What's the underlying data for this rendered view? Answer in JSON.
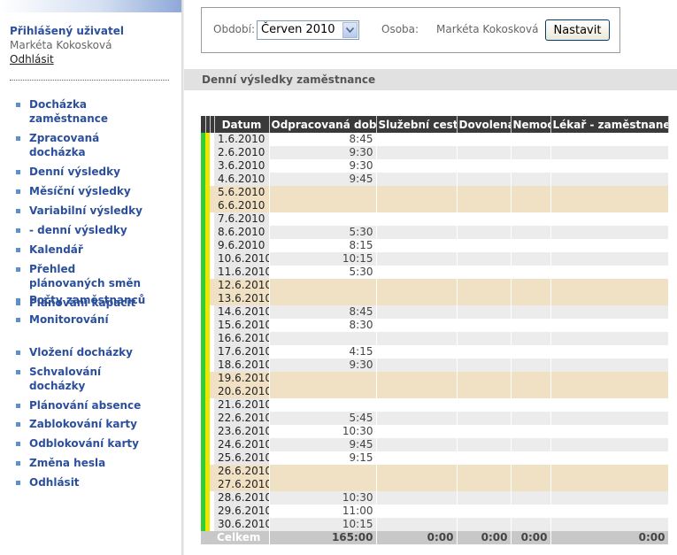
{
  "user": {
    "heading": "Přihlášený uživatel",
    "name": "Markéta Kokosková",
    "logout": "Odhlásit"
  },
  "nav_groups": [
    [
      "Docházka zaměstnance",
      "Zpracovaná docházka",
      "Denní výsledky",
      "Měsíční výsledky",
      "Variabilní výsledky",
      "- denní výsledky",
      "Kalendář",
      "Přehled plánovaných směn",
      "Plánování kapacit"
    ],
    [
      "Počty zaměstnanců",
      "Monitorování"
    ],
    [
      "Vložení docházky",
      "Schvalování docházky",
      "Plánování absence"
    ],
    [
      "Zablokování karty",
      "Odblokování karty",
      "Změna hesla",
      "Odhlásit"
    ]
  ],
  "filter": {
    "period_label": "Období:",
    "period_value": "Červen 2010",
    "person_label": "Osoba:",
    "person_value": "Markéta Kokosková",
    "set_button": "Nastavit"
  },
  "section_title": "Denní výsledky zaměstnance",
  "table": {
    "columns": [
      "Datum",
      "Odpracovaná doba",
      "Služební cesta",
      "Dovolená",
      "Nemoc",
      "Lékař - zaměstnanec"
    ],
    "rows": [
      {
        "date": "1.6.2010",
        "worked": "8:45",
        "weekend": false
      },
      {
        "date": "2.6.2010",
        "worked": "9:30",
        "weekend": false
      },
      {
        "date": "3.6.2010",
        "worked": "9:30",
        "weekend": false
      },
      {
        "date": "4.6.2010",
        "worked": "9:45",
        "weekend": false
      },
      {
        "date": "5.6.2010",
        "worked": "",
        "weekend": true
      },
      {
        "date": "6.6.2010",
        "worked": "",
        "weekend": true
      },
      {
        "date": "7.6.2010",
        "worked": "",
        "weekend": false
      },
      {
        "date": "8.6.2010",
        "worked": "5:30",
        "weekend": false
      },
      {
        "date": "9.6.2010",
        "worked": "8:15",
        "weekend": false
      },
      {
        "date": "10.6.2010",
        "worked": "10:15",
        "weekend": false
      },
      {
        "date": "11.6.2010",
        "worked": "5:30",
        "weekend": false
      },
      {
        "date": "12.6.2010",
        "worked": "",
        "weekend": true
      },
      {
        "date": "13.6.2010",
        "worked": "",
        "weekend": true
      },
      {
        "date": "14.6.2010",
        "worked": "8:45",
        "weekend": false
      },
      {
        "date": "15.6.2010",
        "worked": "8:30",
        "weekend": false
      },
      {
        "date": "16.6.2010",
        "worked": "",
        "weekend": false
      },
      {
        "date": "17.6.2010",
        "worked": "4:15",
        "weekend": false
      },
      {
        "date": "18.6.2010",
        "worked": "9:30",
        "weekend": false
      },
      {
        "date": "19.6.2010",
        "worked": "",
        "weekend": true
      },
      {
        "date": "20.6.2010",
        "worked": "",
        "weekend": true
      },
      {
        "date": "21.6.2010",
        "worked": "",
        "weekend": false
      },
      {
        "date": "22.6.2010",
        "worked": "5:45",
        "weekend": false
      },
      {
        "date": "23.6.2010",
        "worked": "10:30",
        "weekend": false
      },
      {
        "date": "24.6.2010",
        "worked": "9:45",
        "weekend": false
      },
      {
        "date": "25.6.2010",
        "worked": "9:15",
        "weekend": false
      },
      {
        "date": "26.6.2010",
        "worked": "",
        "weekend": true
      },
      {
        "date": "27.6.2010",
        "worked": "",
        "weekend": true
      },
      {
        "date": "28.6.2010",
        "worked": "10:30",
        "weekend": false
      },
      {
        "date": "29.6.2010",
        "worked": "11:00",
        "weekend": false
      },
      {
        "date": "30.6.2010",
        "worked": "10:15",
        "weekend": false
      }
    ],
    "total": {
      "label": "Celkem",
      "worked": "165:00",
      "trip": "0:00",
      "vacation": "0:00",
      "sick": "0:00",
      "doctor": "0:00"
    }
  },
  "colors": {
    "nav_text": "#2b4f9c",
    "nav_bullet": "#5b8fd0",
    "weekend_row": "#f1e1c4",
    "header_bg": "#3a3a3a",
    "indicator_green": "#33cc33",
    "indicator_yellow": "#e8e800",
    "total_bg": "#c8c8c8"
  }
}
